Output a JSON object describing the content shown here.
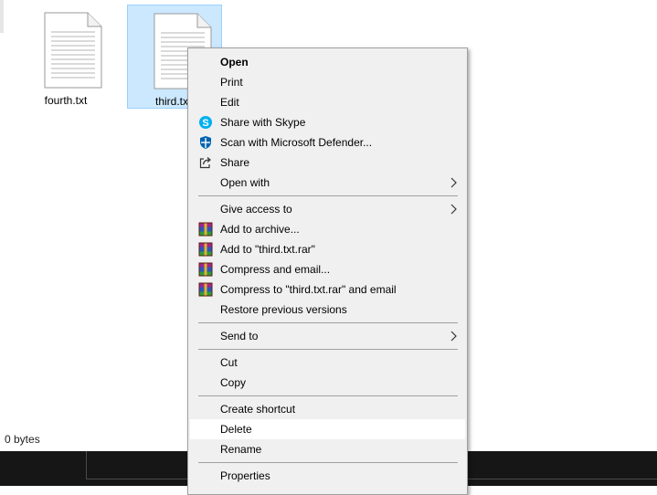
{
  "files": [
    {
      "name": "fourth.txt",
      "selected": false
    },
    {
      "name": "third.txt",
      "selected": true
    }
  ],
  "status_bar": {
    "text": "0 bytes"
  },
  "context_menu": {
    "open": "Open",
    "print": "Print",
    "edit": "Edit",
    "share_skype": "Share with Skype",
    "scan_defender": "Scan with Microsoft Defender...",
    "share": "Share",
    "open_with": "Open with",
    "give_access": "Give access to",
    "add_archive": "Add to archive...",
    "add_rar": "Add to \"third.txt.rar\"",
    "compress_email": "Compress and email...",
    "compress_rar_email": "Compress to \"third.txt.rar\" and email",
    "restore": "Restore previous versions",
    "send_to": "Send to",
    "cut": "Cut",
    "copy": "Copy",
    "create_shortcut": "Create shortcut",
    "delete": "Delete",
    "rename": "Rename",
    "properties": "Properties",
    "hovered_item": "Delete"
  },
  "colors": {
    "selection_fill": "#cce8ff",
    "selection_border": "#99d1ff",
    "menu_background": "#f0f0f0",
    "hover_background": "#ffffff",
    "taskbar": "#161616",
    "skype_blue": "#00aff0",
    "defender_blue": "#0063b1"
  },
  "icons": {
    "file_type": "text-document-icon",
    "skype": "skype-icon",
    "defender": "defender-shield-icon",
    "share": "share-icon",
    "archive": "winrar-icon",
    "submenu": "chevron-right-icon"
  }
}
